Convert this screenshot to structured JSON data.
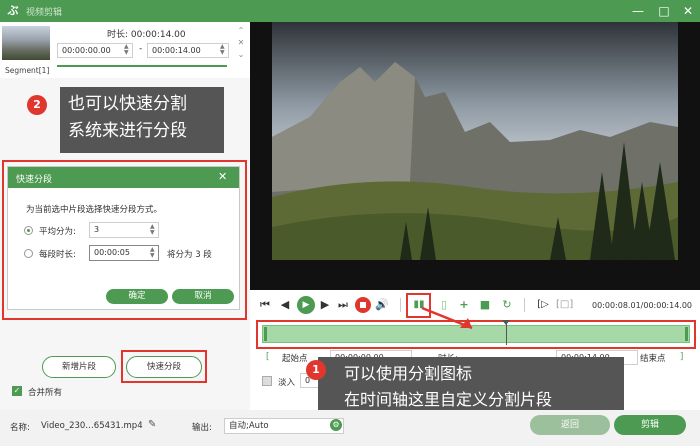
{
  "window": {
    "title": "视频剪辑",
    "logo": "ぶ"
  },
  "window_controls": {
    "minimize": "—",
    "maximize": "□",
    "close": "✕"
  },
  "segment": {
    "label": "Segment[1]",
    "duration_label": "时长: 00:00:14.00",
    "start": "00:00:00.00",
    "end": "00:00:14.00",
    "dash": "-"
  },
  "callout_top": {
    "badge": "2",
    "line1": "也可以快速分割",
    "line2": "系统来进行分段"
  },
  "dialog": {
    "title": "快速分段",
    "close_icon": "✕",
    "prompt": "为当前选中片段选择快速分段方式。",
    "option1_label": "平均分为:",
    "option1_value": "3",
    "option2_label": "每段时长:",
    "option2_value": "00:00:05",
    "option2_note": "将分为 3 段",
    "ok": "确定",
    "cancel": "取消"
  },
  "left_buttons": {
    "add_segment": "新增片段",
    "quick_split": "快速分段"
  },
  "merge_all": {
    "label": "合并所有",
    "checked": true
  },
  "player": {
    "time": "00:00:08.01/00:00:14.00",
    "timeline_progress": 0.571
  },
  "range": {
    "open_bracket": "[",
    "start_label": "起始点",
    "start_value": "00:00:00.00",
    "duration_label": "时长:",
    "duration_value": "00:00:14.00",
    "end_label": "结束点",
    "close_bracket": "]"
  },
  "fade": {
    "label": "淡入",
    "value": "0"
  },
  "callout_bottom": {
    "badge": "1",
    "line1": "可以使用分割图标",
    "line2": "在时间轴这里自定义分割片段"
  },
  "bottom": {
    "name_label": "名称:",
    "name_value": "Video_230…65431.mp4",
    "output_label": "输出:",
    "output_value": "自动;Auto",
    "back": "返回",
    "cut": "剪辑"
  },
  "colors": {
    "brand_green": "#4d9a52",
    "callout_gray": "#555555",
    "highlight_red": "#e0362d",
    "timeline_green": "#a7d8a7"
  }
}
